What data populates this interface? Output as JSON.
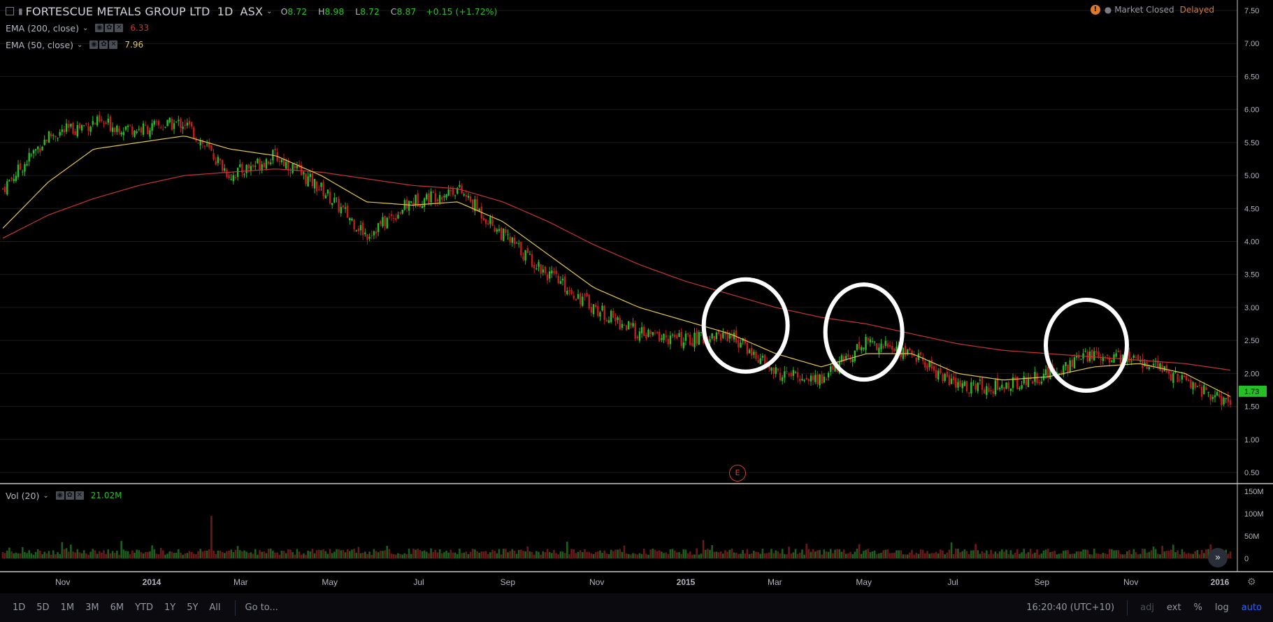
{
  "header": {
    "symbol_title": "FORTESCUE METALS GROUP LTD",
    "interval": "1D",
    "exchange": "ASX",
    "ohlc": {
      "o_label": "O",
      "o": "8.72",
      "h_label": "H",
      "h": "8.98",
      "l_label": "L",
      "l": "8.72",
      "c_label": "C",
      "c": "8.87",
      "change": "+0.15 (+1.72%)"
    }
  },
  "indicators": {
    "ema200": {
      "label": "EMA (200, close)",
      "value": "6.33",
      "color": "#c93434"
    },
    "ema50": {
      "label": "EMA (50, close)",
      "value": "7.96",
      "color": "#e6c84a"
    },
    "vol": {
      "label": "Vol (20)",
      "value": "21.02M"
    }
  },
  "status": {
    "market": "Market Closed",
    "feed": "Delayed"
  },
  "price_axis": {
    "labels": [
      "7.50",
      "7.00",
      "6.50",
      "6.00",
      "5.50",
      "5.00",
      "4.50",
      "4.00",
      "3.50",
      "3.00",
      "2.50",
      "2.00",
      "1.50",
      "1.00",
      "0.50"
    ],
    "last_price": "1.73",
    "last_price_color": "#26c026"
  },
  "volume_axis": {
    "labels": [
      "150M",
      "100M",
      "50M",
      "0"
    ]
  },
  "time_axis": {
    "labels": [
      "Nov",
      "2014",
      "Mar",
      "May",
      "Jul",
      "Sep",
      "Nov",
      "2015",
      "Mar",
      "May",
      "Jul",
      "Sep",
      "Nov",
      "2016"
    ]
  },
  "event_badge": "E",
  "bottom_bar": {
    "ranges": [
      "1D",
      "5D",
      "1M",
      "3M",
      "6M",
      "YTD",
      "1Y",
      "5Y",
      "All"
    ],
    "goto": "Go to...",
    "clock": "16:20:40 (UTC+10)",
    "adj": "adj",
    "ext": "ext",
    "percent": "%",
    "log": "log",
    "auto": "auto"
  },
  "colors": {
    "up": "#26c026",
    "down": "#c41c1c",
    "vol_up": "#1e5e1e",
    "vol_down": "#6a1a1a",
    "grid": "#1a1a1a",
    "accent": "#2962ff"
  },
  "chart_data": {
    "type": "line",
    "title": "",
    "ylabel": "",
    "ylim": [
      0.5,
      7.5
    ],
    "series": [
      {
        "name": "",
        "x": [
          "2013-10",
          "2013-11",
          "2013-12",
          "2014-01",
          "2014-02",
          "2014-03",
          "2014-04",
          "2014-05",
          "2014-06",
          "2014-07",
          "2014-08",
          "2014-09",
          "2014-10",
          "2014-11",
          "2014-12",
          "2015-01",
          "2015-02",
          "2015-03",
          "2015-04",
          "2015-05",
          "2015-06",
          "2015-07",
          "2015-08",
          "2015-09",
          "2015-10",
          "2015-11",
          "2015-12",
          "2016-01"
        ],
        "values": [
          4.8,
          5.6,
          5.8,
          5.7,
          5.8,
          5.0,
          5.3,
          4.8,
          4.1,
          4.6,
          4.8,
          4.1,
          3.5,
          3.0,
          2.6,
          2.5,
          2.6,
          2.0,
          1.9,
          2.5,
          2.3,
          1.8,
          1.8,
          2.0,
          2.3,
          2.2,
          1.9,
          1.5
        ]
      },
      {
        "name": "EMA (50, close)",
        "x": [
          "2013-10",
          "2013-11",
          "2013-12",
          "2014-01",
          "2014-02",
          "2014-03",
          "2014-04",
          "2014-05",
          "2014-06",
          "2014-07",
          "2014-08",
          "2014-09",
          "2014-10",
          "2014-11",
          "2014-12",
          "2015-01",
          "2015-02",
          "2015-03",
          "2015-04",
          "2015-05",
          "2015-06",
          "2015-07",
          "2015-08",
          "2015-09",
          "2015-10",
          "2015-11",
          "2015-12",
          "2016-01"
        ],
        "values": [
          4.2,
          4.9,
          5.4,
          5.5,
          5.6,
          5.4,
          5.3,
          5.0,
          4.6,
          4.55,
          4.6,
          4.3,
          3.8,
          3.3,
          3.0,
          2.8,
          2.6,
          2.3,
          2.1,
          2.3,
          2.3,
          2.0,
          1.9,
          1.95,
          2.1,
          2.15,
          2.0,
          1.65
        ]
      },
      {
        "name": "EMA (200, close)",
        "x": [
          "2013-10",
          "2013-11",
          "2013-12",
          "2014-01",
          "2014-02",
          "2014-03",
          "2014-04",
          "2014-05",
          "2014-06",
          "2014-07",
          "2014-08",
          "2014-09",
          "2014-10",
          "2014-11",
          "2014-12",
          "2015-01",
          "2015-02",
          "2015-03",
          "2015-04",
          "2015-05",
          "2015-06",
          "2015-07",
          "2015-08",
          "2015-09",
          "2015-10",
          "2015-11",
          "2015-12",
          "2016-01"
        ],
        "values": [
          4.05,
          4.4,
          4.65,
          4.85,
          5.0,
          5.05,
          5.1,
          5.05,
          4.95,
          4.85,
          4.8,
          4.6,
          4.3,
          3.95,
          3.65,
          3.4,
          3.2,
          3.0,
          2.85,
          2.75,
          2.6,
          2.45,
          2.35,
          2.3,
          2.25,
          2.2,
          2.15,
          2.05
        ]
      }
    ],
    "volume": {
      "label": "Vol (20)",
      "ylim": [
        0,
        150
      ]
    },
    "highlights": [
      "2015-02",
      "2015-05",
      "2015-10"
    ]
  }
}
